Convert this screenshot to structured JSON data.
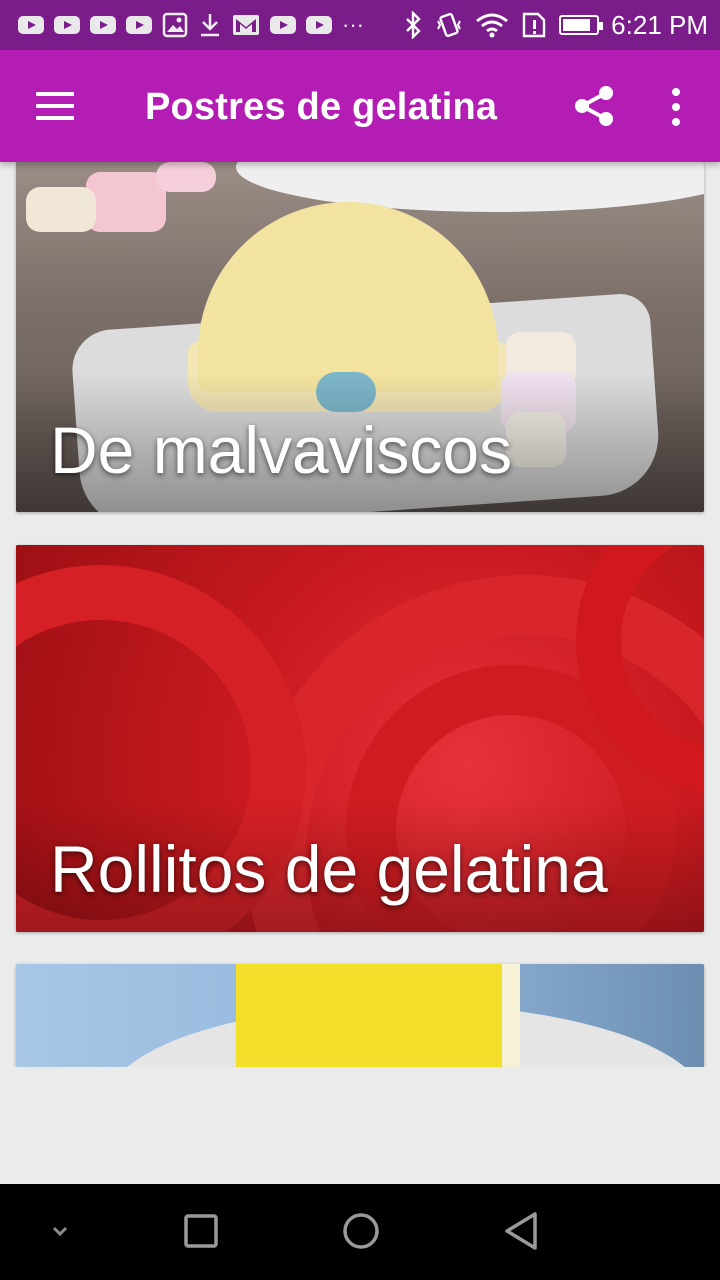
{
  "status_bar": {
    "time": "6:21 PM",
    "more_notifications": "···",
    "notification_icons": [
      "youtube-icon",
      "youtube-icon",
      "youtube-icon",
      "youtube-icon",
      "gallery-icon",
      "download-icon",
      "gmail-icon",
      "youtube-icon",
      "youtube-icon"
    ],
    "system_icons": [
      "bluetooth-icon",
      "vibrate-icon",
      "wifi-icon",
      "sim-alert-icon",
      "battery-icon"
    ],
    "battery_level": 0.85
  },
  "app_bar": {
    "title": "Postres de gelatina",
    "menu_icon": "hamburger-menu-icon",
    "share_icon": "share-icon",
    "overflow_icon": "more-vert-icon",
    "color": "#b31db4"
  },
  "recipes": [
    {
      "title": "De malvaviscos"
    },
    {
      "title": "Rollitos de gelatina"
    }
  ],
  "nav_bar": {
    "buttons": [
      "chevron-down-icon",
      "recents-square-icon",
      "home-circle-icon",
      "back-triangle-icon"
    ]
  },
  "colors": {
    "status_bar": "#7a1d8a",
    "app_bar": "#b31db4",
    "background": "#ebebeb",
    "nav_bar": "#000000"
  }
}
